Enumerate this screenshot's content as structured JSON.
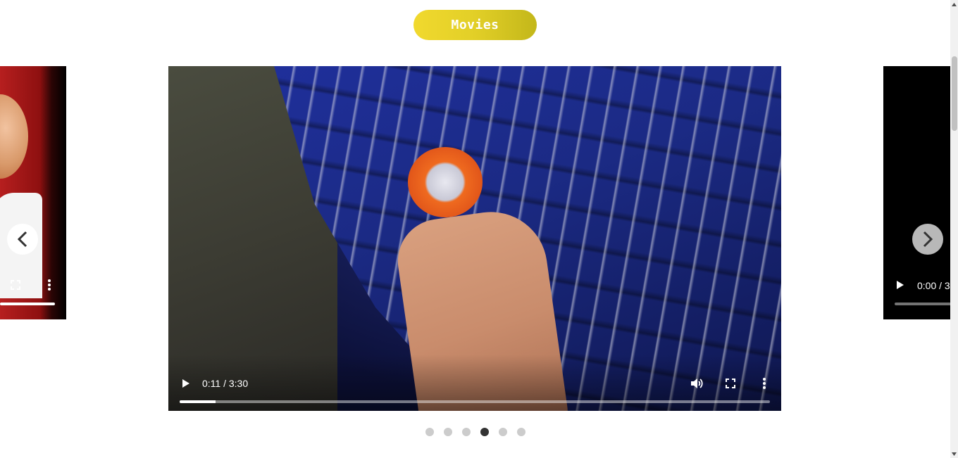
{
  "header": {
    "category_button_label": "Movies"
  },
  "carousel": {
    "prev_slide": {
      "icons": [
        "fullscreen-icon",
        "more-options-icon"
      ],
      "progress": 1.0
    },
    "current_slide": {
      "time_display": "0:11 / 3:30",
      "progress": 0.061,
      "icons": [
        "play-icon",
        "volume-icon",
        "fullscreen-icon",
        "more-options-icon"
      ]
    },
    "next_slide": {
      "time_display": "0:00 / 3",
      "icons": [
        "play-icon"
      ]
    },
    "arrows": {
      "prev": "chevron-left-icon",
      "next": "chevron-right-icon"
    },
    "dots": {
      "count": 6,
      "active_index": 3
    }
  },
  "colors": {
    "button_gradient_start": "#f1d92e",
    "button_gradient_end": "#c3b71a",
    "active_dot": "#333333",
    "inactive_dot": "#cccccc"
  }
}
